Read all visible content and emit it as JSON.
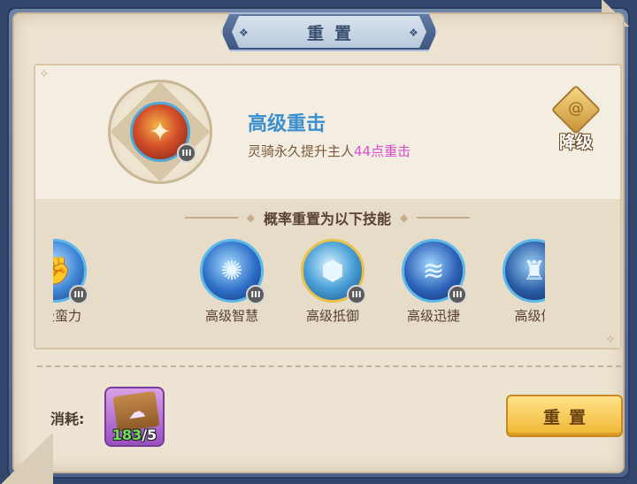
{
  "title": "重置",
  "current_skill": {
    "name": "高级重击",
    "desc_prefix": "灵骑永久提升主人",
    "desc_highlight": "44点重击",
    "level": "III",
    "icon": "axe-strike-icon",
    "highlight_color": "#d650c8"
  },
  "downgrade": {
    "label": "降级",
    "icon": "swirl-icon"
  },
  "section_title": "概率重置为以下技能",
  "possible_skills": [
    {
      "label": "高级蛮力",
      "level": "III",
      "icon": "fist-power-icon",
      "color": "#3f86d6"
    },
    {
      "label": "高级智慧",
      "level": "III",
      "icon": "brain-wisdom-icon",
      "color": "#2f6fc8"
    },
    {
      "label": "高级抵御",
      "level": "III",
      "icon": "shield-gem-icon",
      "color": "#4aa0d8"
    },
    {
      "label": "高级迅捷",
      "level": "III",
      "icon": "swift-wind-icon",
      "color": "#2e63b8"
    },
    {
      "label": "高级体",
      "level": "III",
      "icon": "body-warrior-icon",
      "color": "#2a5ea6"
    }
  ],
  "cost": {
    "label": "消耗:",
    "have": "183",
    "need": "/5",
    "item_icon": "skill-book-icon"
  },
  "reset_button": "重置"
}
